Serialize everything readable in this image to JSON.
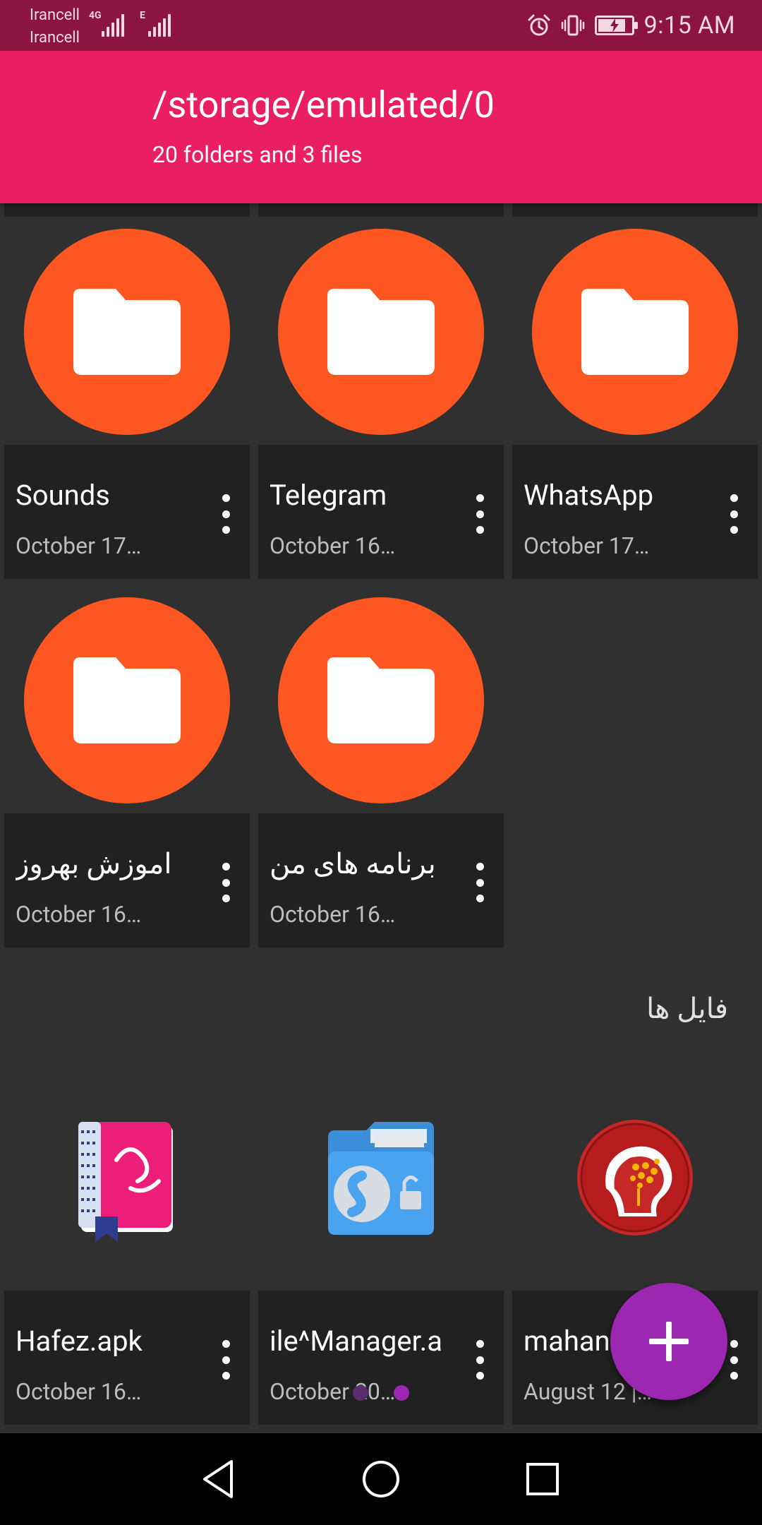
{
  "status_bar": {
    "carrier_1": "Irancell",
    "carrier_2": "Irancell",
    "network_1": "4G",
    "network_2": "E",
    "time": "9:15 AM",
    "icons": [
      "alarm-icon",
      "vibrate-icon",
      "battery-charging-icon"
    ],
    "battery_level": 0.85
  },
  "app_bar": {
    "title": "/storage/emulated/0",
    "subtitle": "20 folders and 3 files"
  },
  "folders": [
    {
      "name": "Sounds",
      "date": "October 17…",
      "icon": "folder-icon"
    },
    {
      "name": "Telegram",
      "date": "October 16…",
      "icon": "folder-icon"
    },
    {
      "name": "WhatsApp",
      "date": "October 17…",
      "icon": "folder-icon"
    },
    {
      "name": "اموزش بهروز",
      "date": "October 16…",
      "icon": "folder-icon"
    },
    {
      "name": "برنامه های من",
      "date": "October 16…",
      "icon": "folder-icon"
    }
  ],
  "files_section": {
    "title": "فایل ها"
  },
  "files": [
    {
      "name": "Hafez.apk",
      "date": "October 16…",
      "icon": "hafez-app-icon"
    },
    {
      "name": "ile^Manager.a",
      "date": "October 20…",
      "icon": "file-manager-app-icon"
    },
    {
      "name": "mahan",
      "date": "August 12 |…",
      "icon": "mahan-app-icon"
    }
  ],
  "fab": {
    "icon": "plus-icon"
  },
  "nav_bar": {
    "icons": [
      "back-icon",
      "home-icon",
      "recents-icon"
    ]
  },
  "colors": {
    "status_bar": "#8B1540",
    "app_bar": "#E91E63",
    "folder_circle": "#FF5722",
    "fab": "#9C27B0",
    "background": "#303030",
    "card": "#212121"
  }
}
